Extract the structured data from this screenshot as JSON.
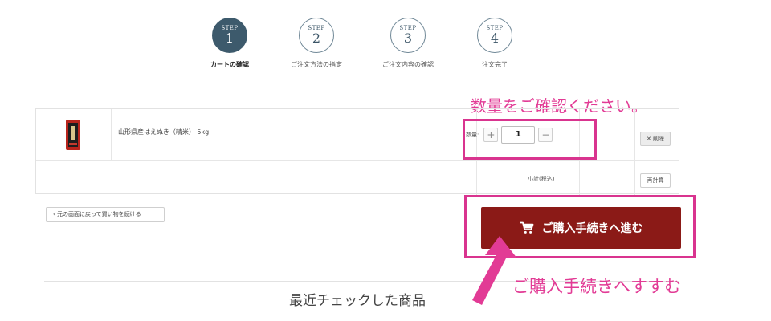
{
  "steps": [
    {
      "word": "STEP",
      "num": "1",
      "label": "カートの確認"
    },
    {
      "word": "STEP",
      "num": "2",
      "label": "ご注文方法の指定"
    },
    {
      "word": "STEP",
      "num": "3",
      "label": "ご注文内容の確認"
    },
    {
      "word": "STEP",
      "num": "4",
      "label": "注文完了"
    }
  ],
  "cart": {
    "product_name": "山形県産はえぬき（精米） 5kg",
    "qty_label": "数量:",
    "qty_value": "1",
    "plus": "+",
    "minus": "−",
    "delete_label": "✕ 削除",
    "subtotal_label": "小計(税込)",
    "recalc_label": "再計算"
  },
  "back_label": "‹ 元の画面に戻って買い物を続ける",
  "checkout_label": "ご購入手続きへ進む",
  "annotations": {
    "qty_note": "数量をご確認ください。",
    "checkout_note": "ご購入手続きへすすむ"
  },
  "recent_title": "最近チェックした商品",
  "colors": {
    "accent_pink": "#d9348f",
    "checkout_bg": "#8b1a17",
    "step_active": "#3d5a6c"
  },
  "icons": {
    "checkout": "cart-icon",
    "arrow": "pointer-arrow"
  }
}
